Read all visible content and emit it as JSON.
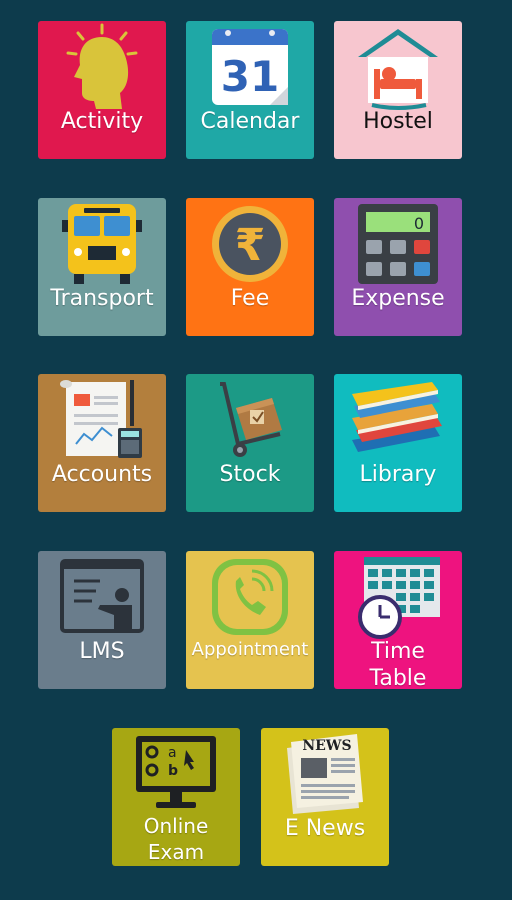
{
  "colors": {
    "background": "#0d3b4c",
    "activity": "#e0184e",
    "calendar": "#1fa8a6",
    "hostel": "#f7c6cf",
    "transport": "#6e9c9c",
    "fee": "#ff7314",
    "expense": "#8f4fae",
    "accounts": "#b37f3d",
    "stock": "#1c9a86",
    "library": "#10bcbf",
    "lms": "#6a7d8c",
    "appointment": "#e5c34f",
    "timetable": "#ee137f",
    "online_exam": "#a7a713",
    "enews": "#d4c21a"
  },
  "tiles": [
    {
      "key": "activity",
      "label": "Activity",
      "icon": "head-idea-icon"
    },
    {
      "key": "calendar",
      "label": "Calendar",
      "icon": "calendar-icon",
      "icon_text": "31"
    },
    {
      "key": "hostel",
      "label": "Hostel",
      "icon": "hostel-bed-icon"
    },
    {
      "key": "transport",
      "label": "Transport",
      "icon": "bus-icon"
    },
    {
      "key": "fee",
      "label": "Fee",
      "icon": "rupee-coin-icon",
      "icon_text": "₹"
    },
    {
      "key": "expense",
      "label": "Expense",
      "icon": "calculator-icon",
      "icon_text": "0"
    },
    {
      "key": "accounts",
      "label": "Accounts",
      "icon": "ledger-calculator-icon"
    },
    {
      "key": "stock",
      "label": "Stock",
      "icon": "hand-truck-box-icon"
    },
    {
      "key": "library",
      "label": "Library",
      "icon": "books-stack-icon"
    },
    {
      "key": "lms",
      "label": "LMS",
      "icon": "teacher-board-icon"
    },
    {
      "key": "appointment",
      "label": "Appointment",
      "icon": "phone-call-icon"
    },
    {
      "key": "timetable",
      "label_line1": "Time",
      "label_line2": "Table",
      "icon": "clock-calendar-icon"
    },
    {
      "key": "online_exam",
      "label_line1": "Online",
      "label_line2": "Exam",
      "icon": "monitor-quiz-icon",
      "icon_text": [
        "a",
        "b"
      ]
    },
    {
      "key": "enews",
      "label": "E News",
      "icon": "newspaper-icon",
      "icon_text": "NEWS"
    }
  ]
}
